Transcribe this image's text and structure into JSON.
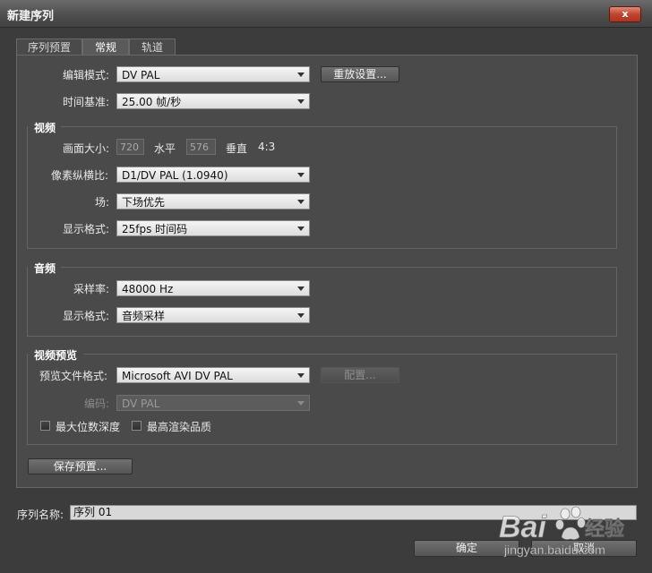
{
  "window": {
    "title": "新建序列",
    "close_label": "x"
  },
  "tabs": [
    "序列预置",
    "常规",
    "轨道"
  ],
  "general": {
    "editing_mode": {
      "label": "编辑模式:",
      "value": "DV PAL"
    },
    "reset_button": "重放设置...",
    "timebase": {
      "label": "时间基准:",
      "value": "25.00 帧/秒"
    }
  },
  "video": {
    "header": "视频",
    "frame_size_label": "画面大小:",
    "width": "720",
    "horizontal_label": "水平",
    "height": "576",
    "vertical_label": "垂直",
    "aspect": "4:3",
    "pixel_aspect": {
      "label": "像素纵横比:",
      "value": "D1/DV PAL (1.0940)"
    },
    "fields": {
      "label": "场:",
      "value": "下场优先"
    },
    "display_format": {
      "label": "显示格式:",
      "value": "25fps 时间码"
    }
  },
  "audio": {
    "header": "音频",
    "sample_rate": {
      "label": "采样率:",
      "value": "48000 Hz"
    },
    "display_format": {
      "label": "显示格式:",
      "value": "音频采样"
    }
  },
  "preview": {
    "header": "视频预览",
    "file_format": {
      "label": "预览文件格式:",
      "value": "Microsoft AVI DV PAL"
    },
    "config_button": "配置...",
    "codec": {
      "label": "编码:",
      "value": "DV PAL"
    },
    "max_bit_depth": {
      "label": "最大位数深度",
      "checked": false
    },
    "max_render_quality": {
      "label": "最高渲染品质",
      "checked": false
    }
  },
  "save_preset_button": "保存预置...",
  "sequence_name": {
    "label": "序列名称:",
    "value": "序列 01"
  },
  "ok_button": "确定",
  "cancel_button": "取消",
  "watermark": {
    "brand": "Bai",
    "brand2": "经验",
    "url": "jingyan.baidu.com"
  },
  "colors": {
    "background": "#3c3c3c",
    "panel": "#4a4a4a",
    "close": "#c0452f"
  }
}
